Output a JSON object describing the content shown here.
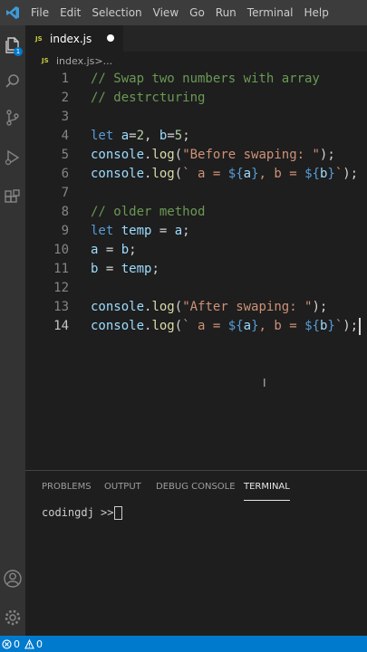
{
  "menu": [
    "File",
    "Edit",
    "Selection",
    "View",
    "Go",
    "Run",
    "Terminal",
    "Help"
  ],
  "activity": {
    "explorer_badge": "1"
  },
  "tab": {
    "filename": "index.js",
    "js_badge": "JS"
  },
  "breadcrumb": {
    "file": "index.js",
    "sep": " > ",
    "ellipsis": "..."
  },
  "code_lines": [
    {
      "n": "1",
      "segments": [
        {
          "c": "cm",
          "t": "// Swap two numbers with array"
        }
      ]
    },
    {
      "n": "2",
      "segments": [
        {
          "c": "cm",
          "t": "// destrcturing"
        }
      ]
    },
    {
      "n": "3",
      "segments": []
    },
    {
      "n": "4",
      "segments": [
        {
          "c": "kw",
          "t": "let "
        },
        {
          "c": "var",
          "t": "a"
        },
        {
          "c": "",
          "t": "="
        },
        {
          "c": "num",
          "t": "2"
        },
        {
          "c": "",
          "t": ", "
        },
        {
          "c": "var",
          "t": "b"
        },
        {
          "c": "",
          "t": "="
        },
        {
          "c": "num",
          "t": "5"
        },
        {
          "c": "",
          "t": ";"
        }
      ]
    },
    {
      "n": "5",
      "segments": [
        {
          "c": "var",
          "t": "console"
        },
        {
          "c": "",
          "t": "."
        },
        {
          "c": "fn",
          "t": "log"
        },
        {
          "c": "",
          "t": "("
        },
        {
          "c": "str",
          "t": "\"Before swaping: \""
        },
        {
          "c": "",
          "t": ");"
        }
      ]
    },
    {
      "n": "6",
      "segments": [
        {
          "c": "var",
          "t": "console"
        },
        {
          "c": "",
          "t": "."
        },
        {
          "c": "fn",
          "t": "log"
        },
        {
          "c": "",
          "t": "("
        },
        {
          "c": "str",
          "t": "` a = "
        },
        {
          "c": "kw",
          "t": "${"
        },
        {
          "c": "var",
          "t": "a"
        },
        {
          "c": "kw",
          "t": "}"
        },
        {
          "c": "str",
          "t": ", b = "
        },
        {
          "c": "kw",
          "t": "${"
        },
        {
          "c": "var",
          "t": "b"
        },
        {
          "c": "kw",
          "t": "}"
        },
        {
          "c": "str",
          "t": "`"
        },
        {
          "c": "",
          "t": ");"
        }
      ]
    },
    {
      "n": "7",
      "segments": []
    },
    {
      "n": "8",
      "segments": [
        {
          "c": "cm",
          "t": "// older method"
        }
      ]
    },
    {
      "n": "9",
      "segments": [
        {
          "c": "kw",
          "t": "let "
        },
        {
          "c": "var",
          "t": "temp"
        },
        {
          "c": "",
          "t": " = "
        },
        {
          "c": "var",
          "t": "a"
        },
        {
          "c": "",
          "t": ";"
        }
      ]
    },
    {
      "n": "10",
      "segments": [
        {
          "c": "var",
          "t": "a"
        },
        {
          "c": "",
          "t": " = "
        },
        {
          "c": "var",
          "t": "b"
        },
        {
          "c": "",
          "t": ";"
        }
      ]
    },
    {
      "n": "11",
      "segments": [
        {
          "c": "var",
          "t": "b"
        },
        {
          "c": "",
          "t": " = "
        },
        {
          "c": "var",
          "t": "temp"
        },
        {
          "c": "",
          "t": ";"
        }
      ]
    },
    {
      "n": "12",
      "segments": []
    },
    {
      "n": "13",
      "segments": [
        {
          "c": "var",
          "t": "console"
        },
        {
          "c": "",
          "t": "."
        },
        {
          "c": "fn",
          "t": "log"
        },
        {
          "c": "",
          "t": "("
        },
        {
          "c": "str",
          "t": "\"After swaping: \""
        },
        {
          "c": "",
          "t": ");"
        }
      ]
    },
    {
      "n": "14",
      "segments": [
        {
          "c": "var",
          "t": "console"
        },
        {
          "c": "",
          "t": "."
        },
        {
          "c": "fn",
          "t": "log"
        },
        {
          "c": "",
          "t": "("
        },
        {
          "c": "str",
          "t": "` a = "
        },
        {
          "c": "kw",
          "t": "${"
        },
        {
          "c": "var",
          "t": "a"
        },
        {
          "c": "kw",
          "t": "}"
        },
        {
          "c": "str",
          "t": ", b = "
        },
        {
          "c": "kw",
          "t": "${"
        },
        {
          "c": "var",
          "t": "b"
        },
        {
          "c": "kw",
          "t": "}"
        },
        {
          "c": "str",
          "t": "`"
        },
        {
          "c": "",
          "t": ");"
        }
      ]
    }
  ],
  "panel": {
    "tabs": [
      "PROBLEMS",
      "OUTPUT",
      "DEBUG CONSOLE",
      "TERMINAL"
    ],
    "active_tab": "TERMINAL",
    "prompt": "codingdj >>"
  },
  "status": {
    "errors": "0",
    "warnings": "0"
  },
  "colors": {
    "accent": "#007acc",
    "comment": "#6a9955",
    "keyword": "#569cd6",
    "string": "#ce9178",
    "number": "#b5cea8",
    "variable": "#9cdcfe",
    "function": "#dcdcaa"
  }
}
